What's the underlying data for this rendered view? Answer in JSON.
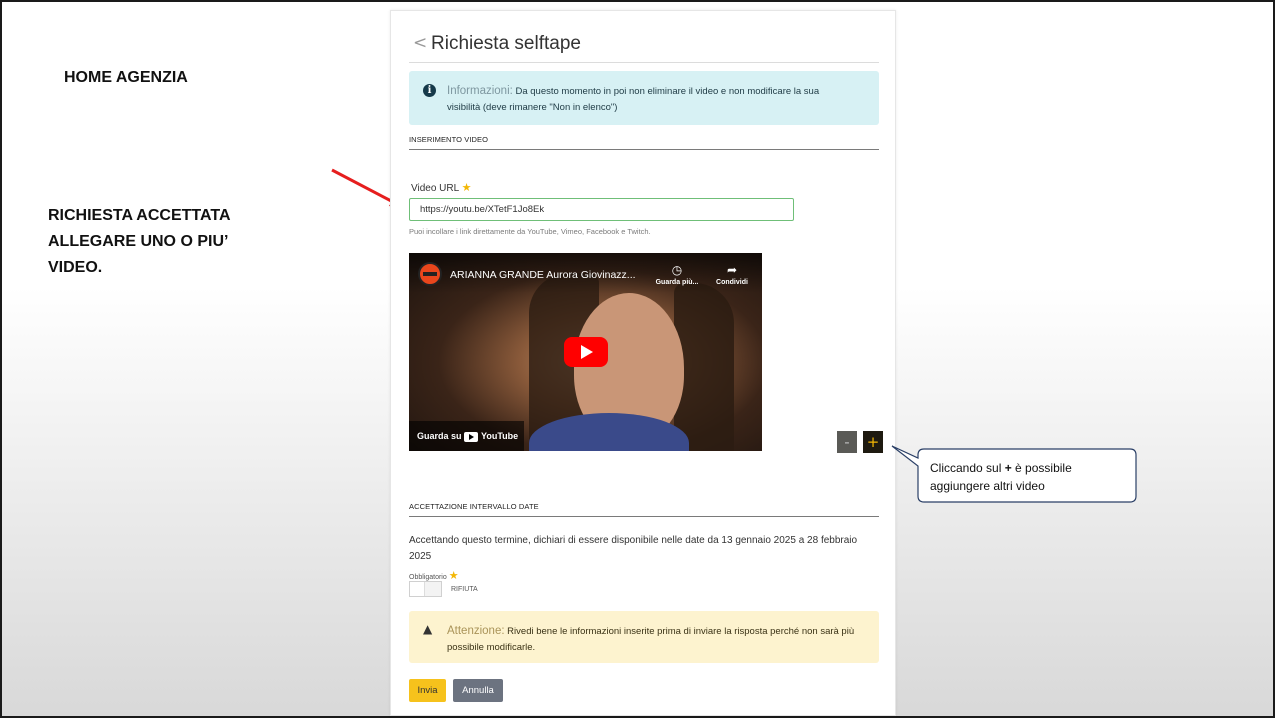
{
  "slide": {
    "home_label": "HOME AGENZIA",
    "status_line1": "RICHIESTA ACCETTATA",
    "status_line2": "ALLEGARE UNO O PIU’",
    "status_line3": "VIDEO.",
    "callout_pre": "Cliccando sul ",
    "callout_plus": "+",
    "callout_post": " è possibile aggiungere altri video"
  },
  "form": {
    "title": "Richiesta selftape",
    "info_prefix": "Informazioni:",
    "info_text": " Da questo momento in poi non eliminare il video e non modificare la sua visibilità (deve rimanere \"Non in elenco\")",
    "section_video": "INSERIMENTO VIDEO",
    "video_url_label": "Video URL",
    "video_url_value": "https://youtu.be/XTetF1Jo8Ek",
    "video_url_help": "Puoi incollare i link direttamente da YouTube, Vimeo, Facebook e Twitch.",
    "player": {
      "title": "ARIANNA GRANDE Aurora Giovinazz...",
      "watch_later": "Guarda più...",
      "share": "Condividi",
      "watch_on": "Guarda su",
      "youtube": "YouTube"
    },
    "minus_label": "-",
    "plus_label": "+",
    "section_dates": "ACCETTAZIONE INTERVALLO DATE",
    "accept_text": "Accettando questo termine, dichiari di essere disponibile nelle date da 13 gennaio 2025 a 28 febbraio 2025",
    "required_label": "Obbligatorio",
    "toggle_state": "RIFIUTA",
    "warn_prefix": "Attenzione:",
    "warn_text": " Rivedi bene le informazioni inserite prima di inviare la risposta perché non sarà più possibile modificarle.",
    "send_label": "Invia",
    "cancel_label": "Annulla"
  },
  "colors": {
    "accent_yellow": "#f6c21c",
    "info_bg": "#d7f1f4",
    "warn_bg": "#fdf3cf",
    "arrow_red": "#e61e1e"
  }
}
